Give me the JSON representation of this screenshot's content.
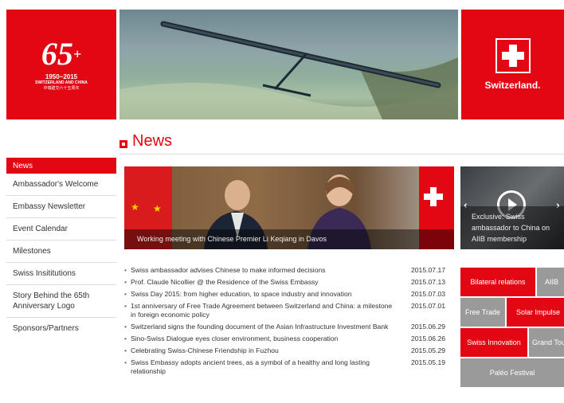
{
  "header": {
    "logo_number": "65",
    "logo_years": "1950~2015",
    "logo_caption": "SWITZERLAND AND CHINA",
    "logo_cn": "中瑞建交六十五周年",
    "brand_label": "Switzerland."
  },
  "section_title": "News",
  "sidebar": {
    "items": [
      {
        "label": "News"
      },
      {
        "label": "Ambassador's Welcome"
      },
      {
        "label": "Embassy Newsletter"
      },
      {
        "label": "Event Calendar"
      },
      {
        "label": "Milestones"
      },
      {
        "label": "Swiss Insititutions"
      },
      {
        "label": "Story Behind the 65th Anniversary Logo"
      },
      {
        "label": "Sponsors/Partners"
      }
    ]
  },
  "feature": {
    "caption": "Working meeting with Chinese Premier Li Keqiang in Davos",
    "side_caption": "Exclusive: Swiss ambassador to China on AIIB membership"
  },
  "news": [
    {
      "title": "Swiss ambassador advises Chinese to make informed decisions",
      "date": "2015.07.17"
    },
    {
      "title": "Prof. Claude Nicollier @ the Residence of the Swiss Embassy",
      "date": "2015.07.13"
    },
    {
      "title": "Swiss Day 2015: from higher education, to space industry and innovation",
      "date": "2015.07.03"
    },
    {
      "title": "1st anniversary of Free Trade Agreement between Switzerland and China: a milestone in foreign economic policy",
      "date": "2015.07.01"
    },
    {
      "title": "Switzerland signs the founding document of the Asian Infrastructure Investment Bank",
      "date": "2015.06.29"
    },
    {
      "title": "Sino-Swiss Dialogue eyes closer environment, business cooperation",
      "date": "2015.06.26"
    },
    {
      "title": "Celebrating Swiss-Chinese Friendship in Fuzhou",
      "date": "2015.05.29"
    },
    {
      "title": "Swiss Embassy adopts ancient trees, as a symbol of a healthy and long lasting relationship",
      "date": "2015.05.19"
    }
  ],
  "tags": {
    "bilateral": "Bilateral relations",
    "aiib": "AIIB",
    "free_trade": "Free Trade",
    "solar": "Solar Impulse",
    "innovation": "Swiss Innovation",
    "grand_tour": "Grand Tou",
    "paleo": "Paléo Festival"
  },
  "colors": {
    "accent": "#e30613",
    "tag_gray": "#9a9a9a"
  }
}
